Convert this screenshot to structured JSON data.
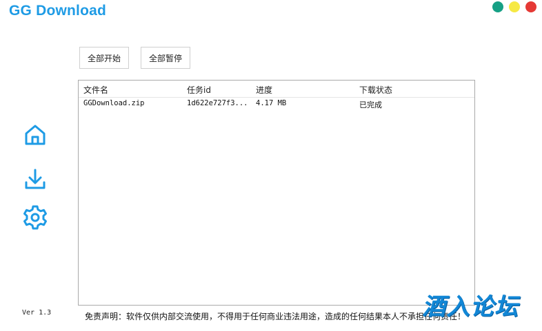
{
  "app": {
    "title": "GG Download",
    "version": "Ver 1.3"
  },
  "window_controls": [
    {
      "name": "maximize",
      "color": "#16a085"
    },
    {
      "name": "minimize",
      "color": "#f6e944"
    },
    {
      "name": "close",
      "color": "#e53935"
    }
  ],
  "sidebar": {
    "accent": "#1e9be5",
    "items": [
      {
        "icon": "home-icon"
      },
      {
        "icon": "download-icon"
      },
      {
        "icon": "gear-icon"
      }
    ]
  },
  "toolbar": {
    "start_all": "全部开始",
    "pause_all": "全部暂停"
  },
  "table": {
    "columns": [
      "文件名",
      "任务id",
      "进度",
      "下载状态"
    ],
    "rows": [
      [
        "GGDownload.zip",
        "1d622e727f3...",
        "4.17 MB",
        "已完成"
      ]
    ]
  },
  "footer": {
    "disclaimer": "免责声明：软件仅供内部交流使用，不得用于任何商业违法用途，造成的任何结果本人不承担任何责任！",
    "watermark": "酒入论坛"
  }
}
